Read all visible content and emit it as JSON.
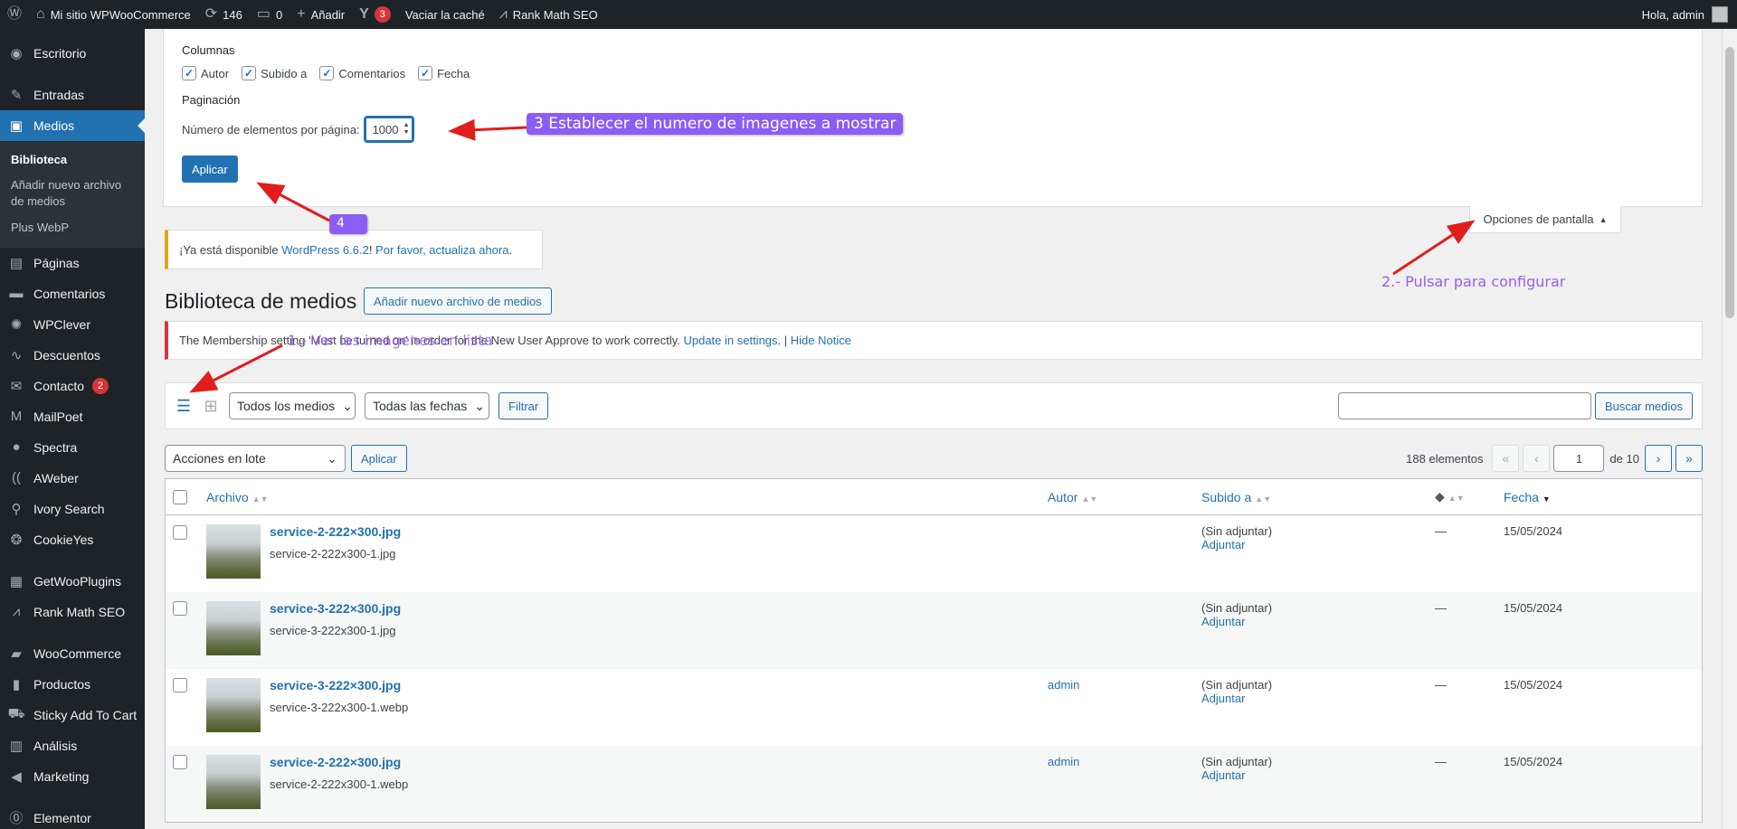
{
  "adminbar": {
    "site_name": "Mi sitio WPWooCommerce",
    "updates_count": "146",
    "comments_count": "0",
    "add_new": "Añadir",
    "yoast_count": "3",
    "clear_cache": "Vaciar la caché",
    "rank_math": "Rank Math SEO",
    "greeting": "Hola, admin"
  },
  "sidebar": {
    "items": [
      {
        "label": "Escritorio",
        "icon": "dashboard-icon"
      },
      {
        "label": "Entradas",
        "icon": "pin-icon"
      },
      {
        "label": "Medios",
        "icon": "media-icon"
      },
      {
        "label": "Páginas",
        "icon": "page-icon"
      },
      {
        "label": "Comentarios",
        "icon": "comment-icon"
      },
      {
        "label": "WPClever",
        "icon": "bulb-icon"
      },
      {
        "label": "Descuentos",
        "icon": "discount-icon"
      },
      {
        "label": "Contacto",
        "icon": "mail-icon",
        "badge": "2"
      },
      {
        "label": "MailPoet",
        "icon": "mailpoet-icon"
      },
      {
        "label": "Spectra",
        "icon": "spectra-icon"
      },
      {
        "label": "AWeber",
        "icon": "aweber-icon"
      },
      {
        "label": "Ivory Search",
        "icon": "search-icon"
      },
      {
        "label": "CookieYes",
        "icon": "cookie-icon"
      },
      {
        "label": "GetWooPlugins",
        "icon": "plugins-icon"
      },
      {
        "label": "Rank Math SEO",
        "icon": "rankmath-icon"
      },
      {
        "label": "WooCommerce",
        "icon": "woo-icon"
      },
      {
        "label": "Productos",
        "icon": "products-icon"
      },
      {
        "label": "Sticky Add To Cart",
        "icon": "cart-icon"
      },
      {
        "label": "Análisis",
        "icon": "analytics-icon"
      },
      {
        "label": "Marketing",
        "icon": "megaphone-icon"
      },
      {
        "label": "Elementor",
        "icon": "elementor-icon"
      }
    ],
    "submenu": [
      "Biblioteca",
      "Añadir nuevo archivo de medios",
      "Plus WebP"
    ]
  },
  "screen_options": {
    "columns_heading": "Columnas",
    "columns": [
      "Autor",
      "Subido a",
      "Comentarios",
      "Fecha"
    ],
    "pagination_heading": "Paginación",
    "per_page_label": "Número de elementos por página:",
    "per_page_value": "1000",
    "apply": "Aplicar",
    "tab_label": "Opciones de pantalla"
  },
  "update_notice": {
    "prefix": "¡Ya está disponible ",
    "version_link": "WordPress 6.6.2",
    "middle": "! ",
    "update_link": "Por favor, actualiza ahora",
    "suffix": "."
  },
  "page": {
    "title": "Biblioteca de medios",
    "add_new": "Añadir nuevo archivo de medios"
  },
  "error_notice": {
    "text": "The Membership setting 'Must be turned on' in order for the New User Approve to work correctly. ",
    "link1": "Update in settings",
    "sep": ". | ",
    "link2": "Hide Notice"
  },
  "filters": {
    "media_type": "Todos los medios",
    "dates": "Todas las fechas",
    "filter_btn": "Filtrar",
    "search_btn": "Buscar medios"
  },
  "tablenav": {
    "bulk": "Acciones en lote",
    "apply": "Aplicar",
    "count": "188 elementos",
    "page": "1",
    "of": "de 10"
  },
  "table": {
    "headers": {
      "file": "Archivo",
      "author": "Autor",
      "uploaded": "Subido a",
      "date": "Fecha"
    },
    "rows": [
      {
        "title": "service-2-222×300.jpg",
        "file": "service-2-222x300-1.jpg",
        "author": "",
        "uploaded": "(Sin adjuntar)",
        "attach": "Adjuntar",
        "comments": "—",
        "date": "15/05/2024"
      },
      {
        "title": "service-3-222×300.jpg",
        "file": "service-3-222x300-1.jpg",
        "author": "",
        "uploaded": "(Sin adjuntar)",
        "attach": "Adjuntar",
        "comments": "—",
        "date": "15/05/2024"
      },
      {
        "title": "service-3-222×300.jpg",
        "file": "service-3-222x300-1.webp",
        "author": "admin",
        "uploaded": "(Sin adjuntar)",
        "attach": "Adjuntar",
        "comments": "—",
        "date": "15/05/2024"
      },
      {
        "title": "service-2-222×300.jpg",
        "file": "service-2-222x300-1.webp",
        "author": "admin",
        "uploaded": "(Sin adjuntar)",
        "attach": "Adjuntar",
        "comments": "—",
        "date": "15/05/2024"
      }
    ]
  },
  "annotations": {
    "step1": "1.- Ver las imagenes en lista",
    "step2": "2.- Pulsar para configurar",
    "step3": "3 Establecer el numero de imagenes a mostrar",
    "step4": "4",
    "color": "#8b5cf6",
    "arrow_color": "#e11d1d"
  }
}
